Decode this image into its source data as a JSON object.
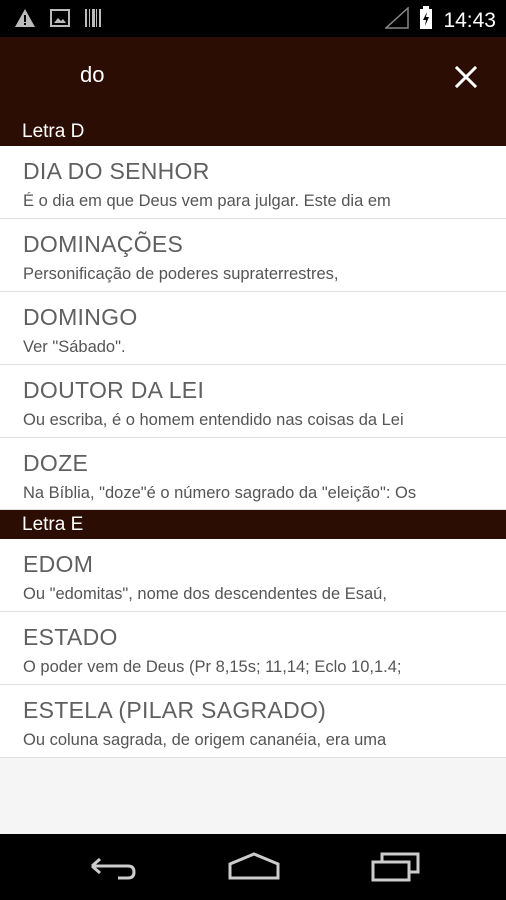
{
  "status_bar": {
    "time": "14:43",
    "icons": [
      "warning-icon",
      "image-icon",
      "barcode-icon",
      "signal-icon",
      "battery-charging-icon"
    ]
  },
  "search": {
    "query": "do"
  },
  "sections": [
    {
      "header": "Letra D",
      "entries": [
        {
          "title": "DIA DO SENHOR",
          "desc": "É o dia em que Deus vem para julgar. Este dia em"
        },
        {
          "title": "DOMINAÇÕES",
          "desc": "Personificação de poderes supraterrestres,"
        },
        {
          "title": "DOMINGO",
          "desc": "Ver \"Sábado\"."
        },
        {
          "title": "DOUTOR DA LEI",
          "desc": "Ou escriba, é o homem entendido nas coisas da Lei"
        },
        {
          "title": "DOZE",
          "desc": "Na Bíblia, \"doze\"é o número sagrado da \"eleição\": Os"
        }
      ]
    },
    {
      "header": "Letra E",
      "entries": [
        {
          "title": "EDOM",
          "desc": "Ou \"edomitas\", nome dos descendentes de Esaú,"
        },
        {
          "title": "ESTADO",
          "desc": "O poder vem de Deus (Pr 8,15s; 11,14; Eclo 10,1.4;"
        },
        {
          "title": "ESTELA (PILAR SAGRADO)",
          "desc": "Ou coluna sagrada, de origem cananéia, era uma"
        }
      ]
    }
  ],
  "nav": [
    "back-icon",
    "home-icon",
    "recents-icon"
  ],
  "colors": {
    "appbar": "#2c0d04",
    "background": "#f5f5f5"
  }
}
